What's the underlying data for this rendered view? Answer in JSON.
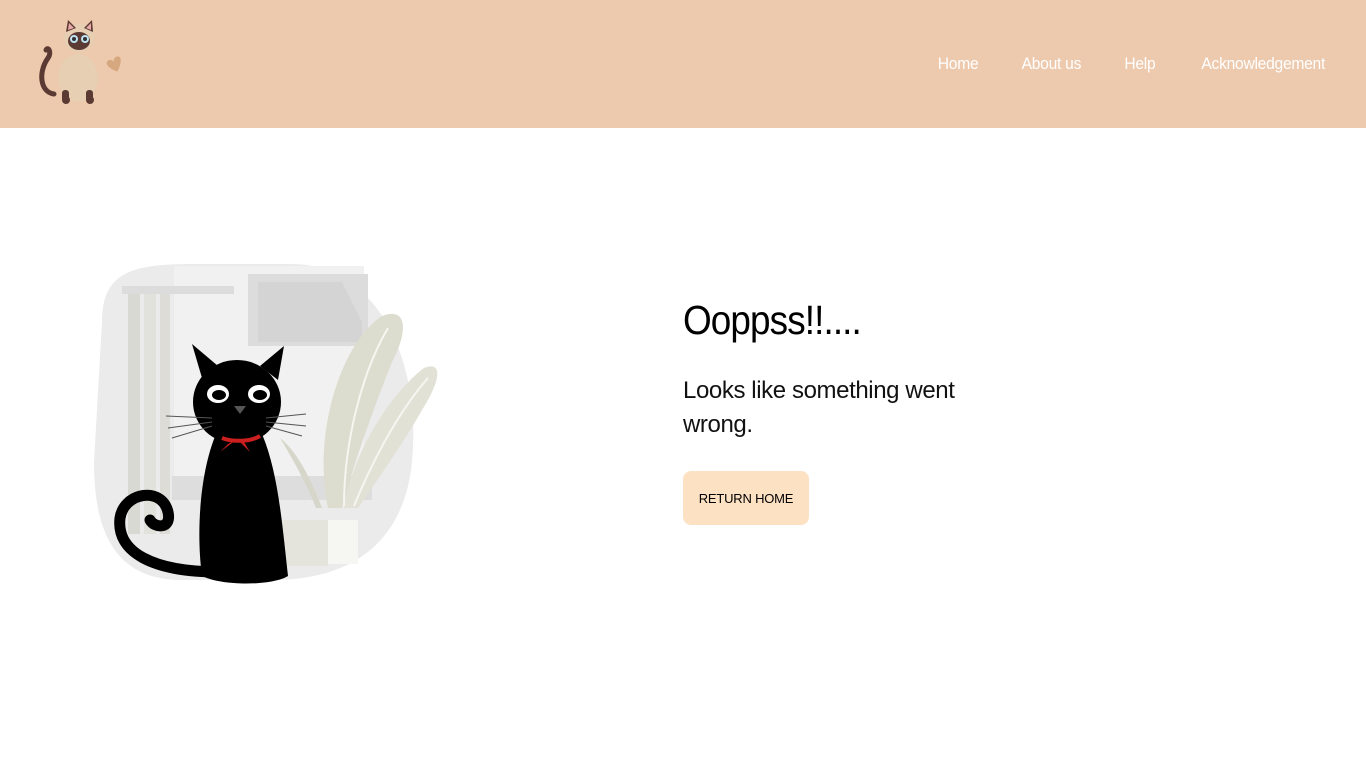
{
  "header": {
    "background_color": "#edc9ad",
    "logo_icon": "siamese-cat-logo-icon"
  },
  "nav": {
    "items": [
      {
        "label": "Home"
      },
      {
        "label": "About us"
      },
      {
        "label": "Help"
      },
      {
        "label": "Acknowledgement"
      }
    ]
  },
  "main": {
    "illustration_icon": "black-cat-with-plant-illustration",
    "title": "Ooppss!!....",
    "message": "Looks like something went wrong.",
    "button_label": "RETURN HOME",
    "button_color": "#fde1c3"
  }
}
